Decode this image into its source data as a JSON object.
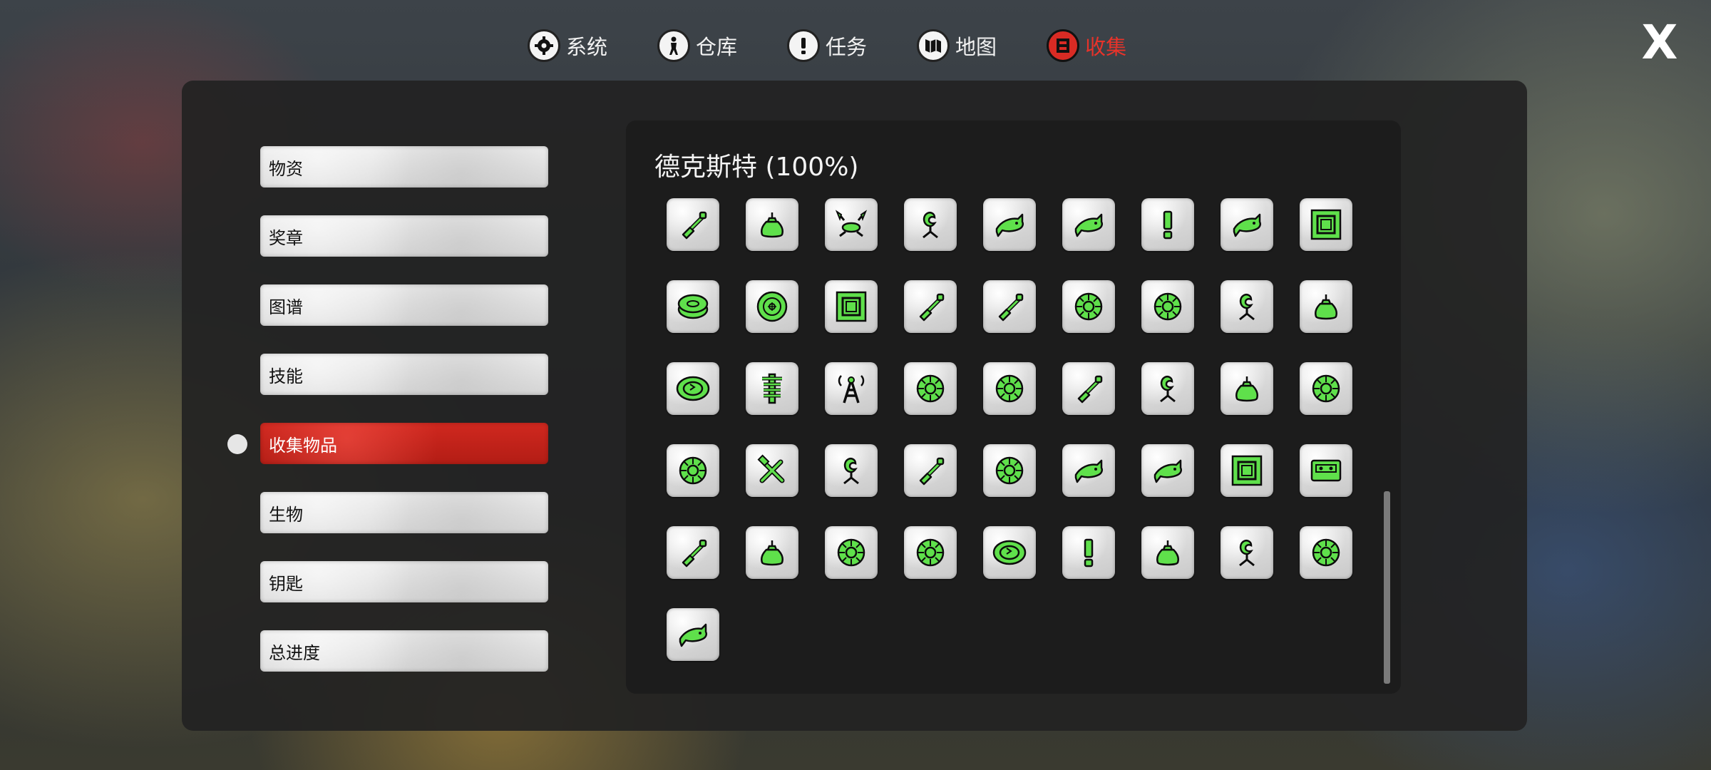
{
  "colors": {
    "accent": "#d92b24",
    "icon_green": "#5fe04b"
  },
  "nav": [
    {
      "label": "系统",
      "icon": "gear-icon"
    },
    {
      "label": "仓库",
      "icon": "person-icon"
    },
    {
      "label": "任务",
      "icon": "exclamation-icon"
    },
    {
      "label": "地图",
      "icon": "map-icon"
    },
    {
      "label": "收集",
      "icon": "collection-icon",
      "active": true
    }
  ],
  "close_label": "X",
  "menu": [
    {
      "label": "物资"
    },
    {
      "label": "奖章"
    },
    {
      "label": "图谱"
    },
    {
      "label": "技能"
    },
    {
      "label": "收集物品",
      "active": true
    },
    {
      "label": "生物"
    },
    {
      "label": "钥匙"
    },
    {
      "label": "总进度"
    }
  ],
  "content": {
    "title": "德克斯特 (100%)",
    "items": [
      "shovel",
      "bag",
      "crab",
      "plant",
      "fish",
      "fish",
      "exclaim",
      "fish",
      "frame",
      "coin",
      "disc",
      "frame",
      "shovel",
      "shovel",
      "flower",
      "flower",
      "plant",
      "bag",
      "ring",
      "spine",
      "tower",
      "flower",
      "flower",
      "shovel",
      "plant",
      "bag",
      "flower",
      "flower",
      "tools",
      "plant",
      "shovel",
      "flower",
      "fish",
      "fish",
      "frame",
      "tape",
      "shovel",
      "bag",
      "flower",
      "flower",
      "ring",
      "exclaim",
      "bag",
      "plant",
      "flower",
      "fish"
    ]
  }
}
